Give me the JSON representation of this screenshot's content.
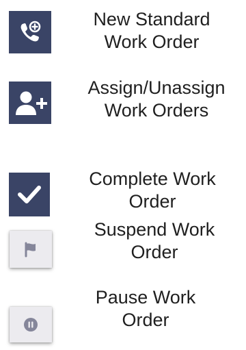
{
  "colors": {
    "dark_button_bg": "#3a4466",
    "light_button_bg": "#ecebef",
    "icon_light_glyph": "#85869a",
    "text": "#1f1f1f"
  },
  "legend": [
    {
      "icon": "phone-add-icon",
      "label_line1": "New Standard",
      "label_line2": "Work Order"
    },
    {
      "icon": "user-add-icon",
      "label_line1": "Assign/Unassign",
      "label_line2": "Work Orders"
    },
    {
      "icon": "checkmark-icon",
      "label_line1": "Complete Work",
      "label_line2": "Order"
    },
    {
      "icon": "flag-icon",
      "label_line1": "Suspend Work",
      "label_line2": "Order"
    },
    {
      "icon": "pause-icon",
      "label_line1": "Pause Work",
      "label_line2": "Order"
    }
  ]
}
